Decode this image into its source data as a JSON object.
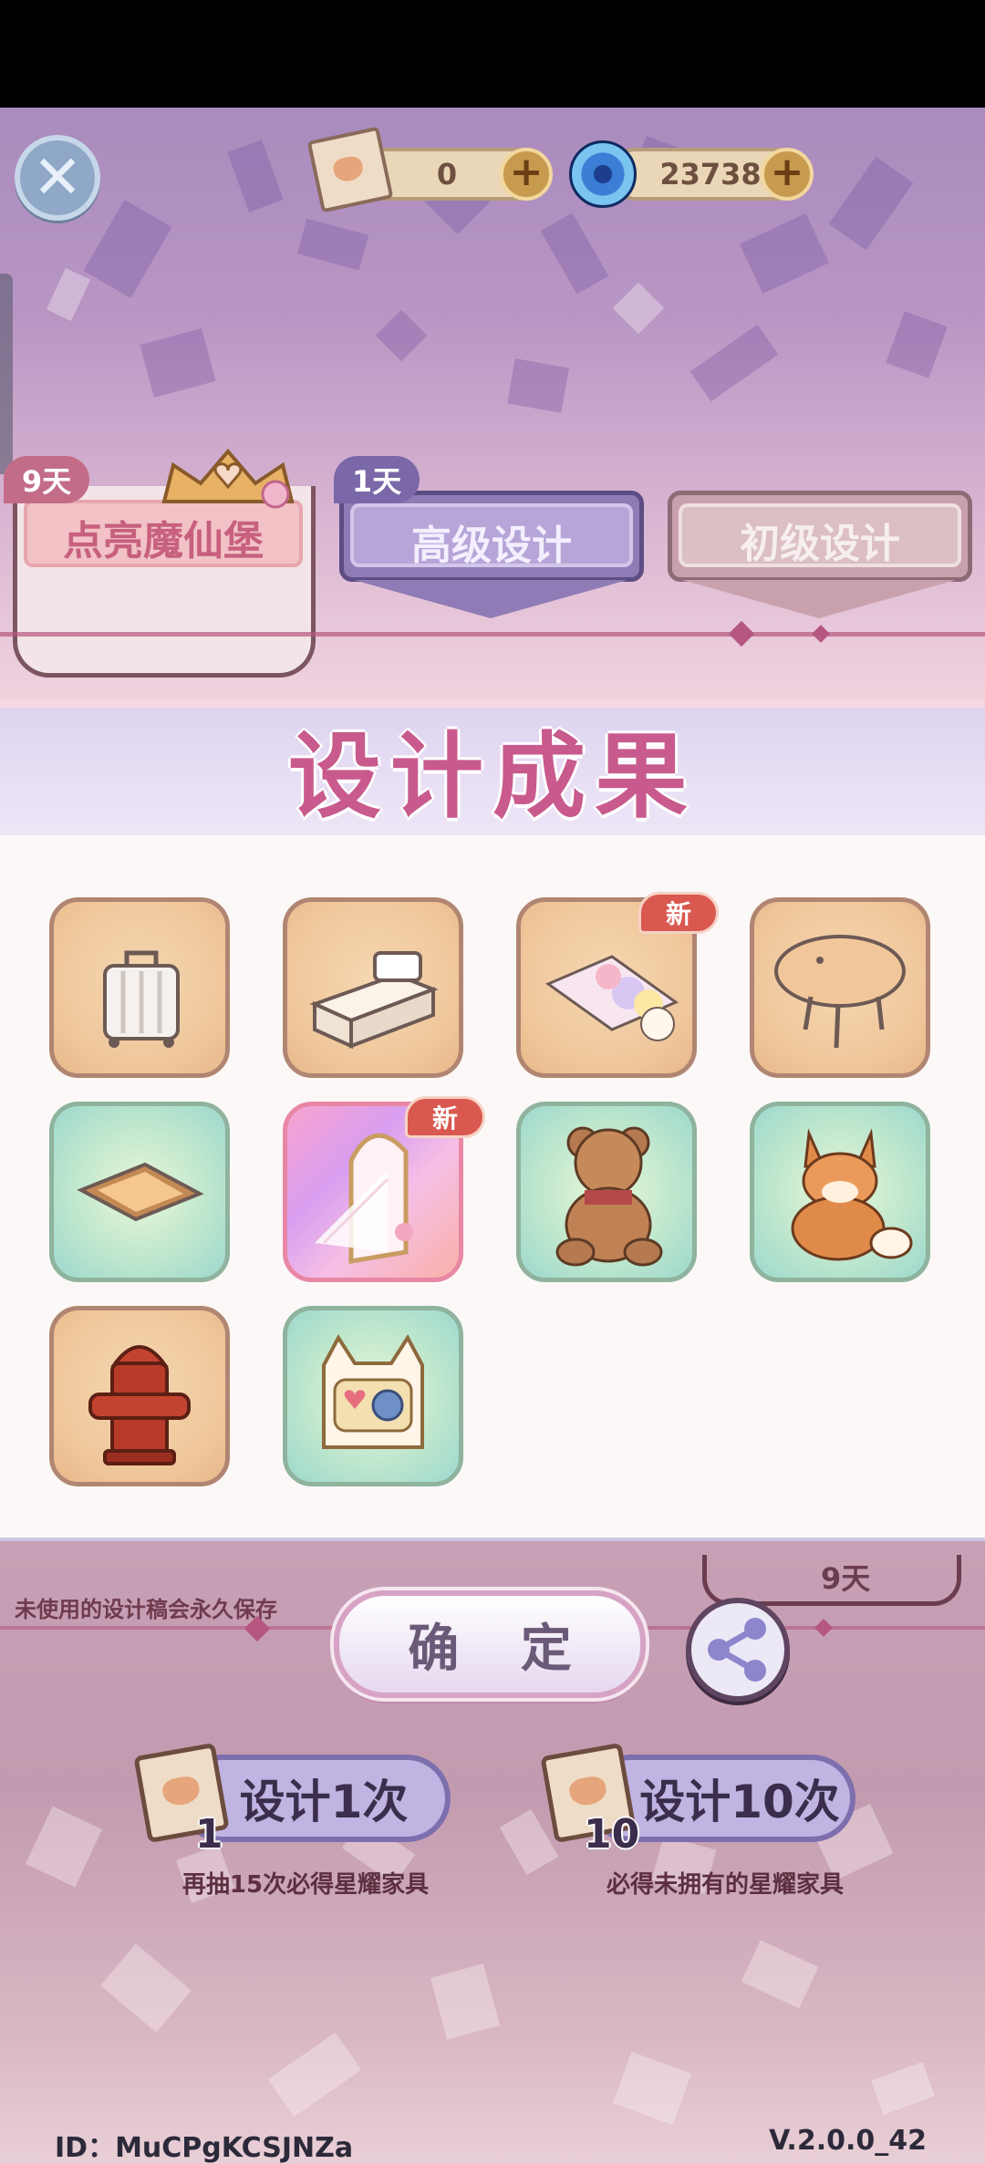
{
  "header": {
    "tickets": "0",
    "gems": "23738"
  },
  "tabs": [
    {
      "label": "点亮魔仙堡",
      "badge": "9天"
    },
    {
      "label": "高级设计",
      "badge": "1天"
    },
    {
      "label": "初级设计"
    }
  ],
  "result_panel": {
    "title": "设计成果",
    "items": [
      {
        "name": "suitcase",
        "is_new": false,
        "rarity": "normal"
      },
      {
        "name": "sink-counter",
        "is_new": false,
        "rarity": "normal"
      },
      {
        "name": "rug",
        "is_new": true,
        "rarity": "normal"
      },
      {
        "name": "oval-table",
        "is_new": false,
        "rarity": "normal"
      },
      {
        "name": "floor-hatch",
        "is_new": false,
        "rarity": "rare"
      },
      {
        "name": "arched-window",
        "is_new": true,
        "rarity": "star"
      },
      {
        "name": "teddy-bear",
        "is_new": false,
        "rarity": "rare"
      },
      {
        "name": "fox-plush",
        "is_new": false,
        "rarity": "rare"
      },
      {
        "name": "fire-hydrant",
        "is_new": false,
        "rarity": "normal"
      },
      {
        "name": "cat-bag",
        "is_new": false,
        "rarity": "rare"
      }
    ],
    "new_label": "新"
  },
  "footer": {
    "notice": "未使用的设计稿会永久保存",
    "timer": "9天",
    "confirm_label": "确 定",
    "design_once": {
      "label": "设计1次",
      "count": "1",
      "hint": "再抽15次必得星耀家具"
    },
    "design_ten": {
      "label": "设计10次",
      "count": "10",
      "hint": "必得未拥有的星耀家具"
    },
    "id_text": "ID：MuCPgKCSJNZa",
    "version": "V.2.0.0_42"
  },
  "colors": {
    "title": "#c85a8d",
    "new_badge": "#d9584f",
    "accent_line": "#b5577e"
  }
}
